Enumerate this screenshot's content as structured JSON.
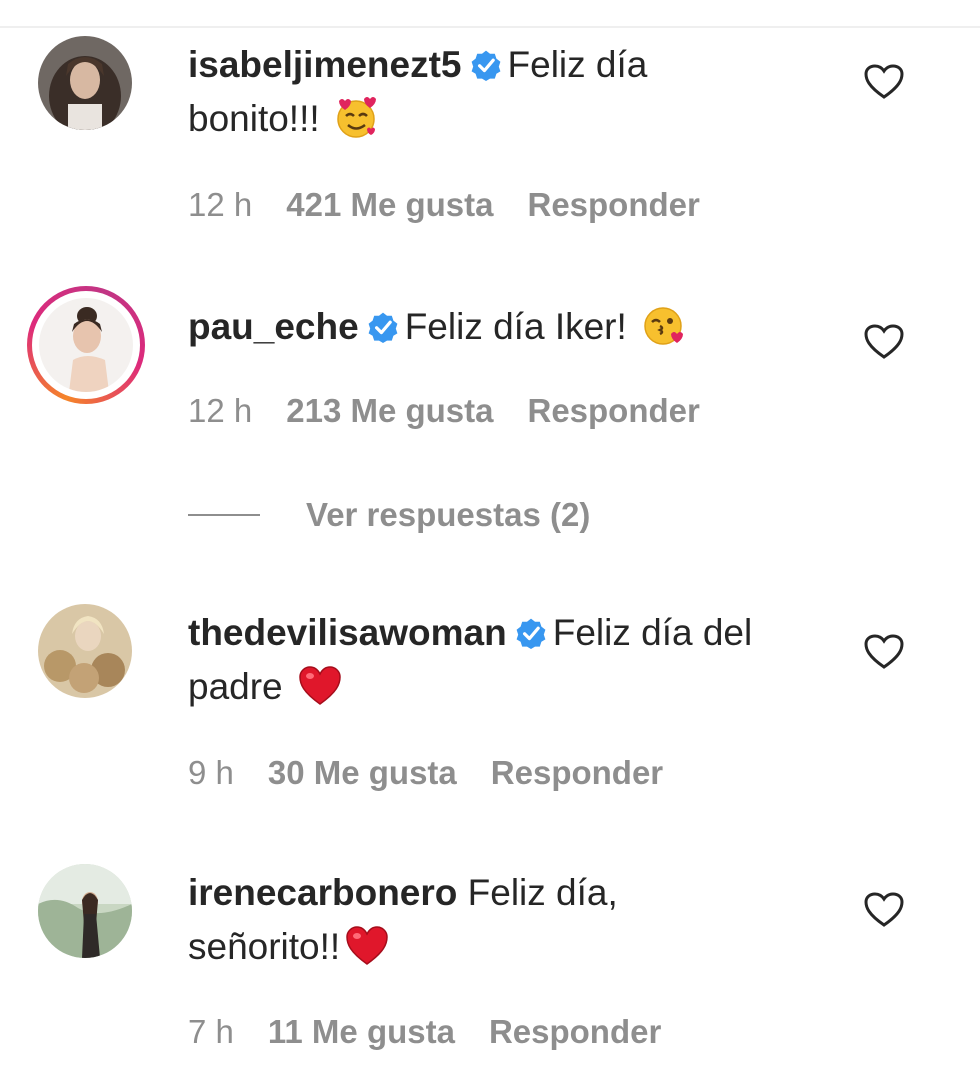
{
  "comments": [
    {
      "username": "isabeljimenezt5",
      "verified": true,
      "text_line1": "Feliz día",
      "text_line2": "bonito!!!",
      "emoji": "smiling-face-with-hearts",
      "time": "12 h",
      "likes": "421 Me gusta",
      "reply": "Responder"
    },
    {
      "username": "pau_eche",
      "verified": true,
      "text_line1": "Feliz día Iker!",
      "emoji": "face-blowing-kiss",
      "time": "12 h",
      "likes": "213 Me gusta",
      "reply": "Responder",
      "view_replies": "Ver respuestas (2)"
    },
    {
      "username": "thedevilisawoman",
      "verified": true,
      "text_line1": "Feliz día del",
      "text_line2": "padre",
      "emoji": "red-heart",
      "time": "9 h",
      "likes": "30 Me gusta",
      "reply": "Responder"
    },
    {
      "username": "irenecarbonero",
      "verified": false,
      "text_line1": "Feliz día,",
      "text_line2": "señorito!!",
      "emoji": "red-heart",
      "time": "7 h",
      "likes": "11 Me gusta",
      "reply": "Responder"
    }
  ],
  "colors": {
    "text": "#262626",
    "meta": "#8e8e8e",
    "verified_badge": "#3897f0",
    "story_ring_start": "#f58529",
    "story_ring_end": "#c13584"
  }
}
